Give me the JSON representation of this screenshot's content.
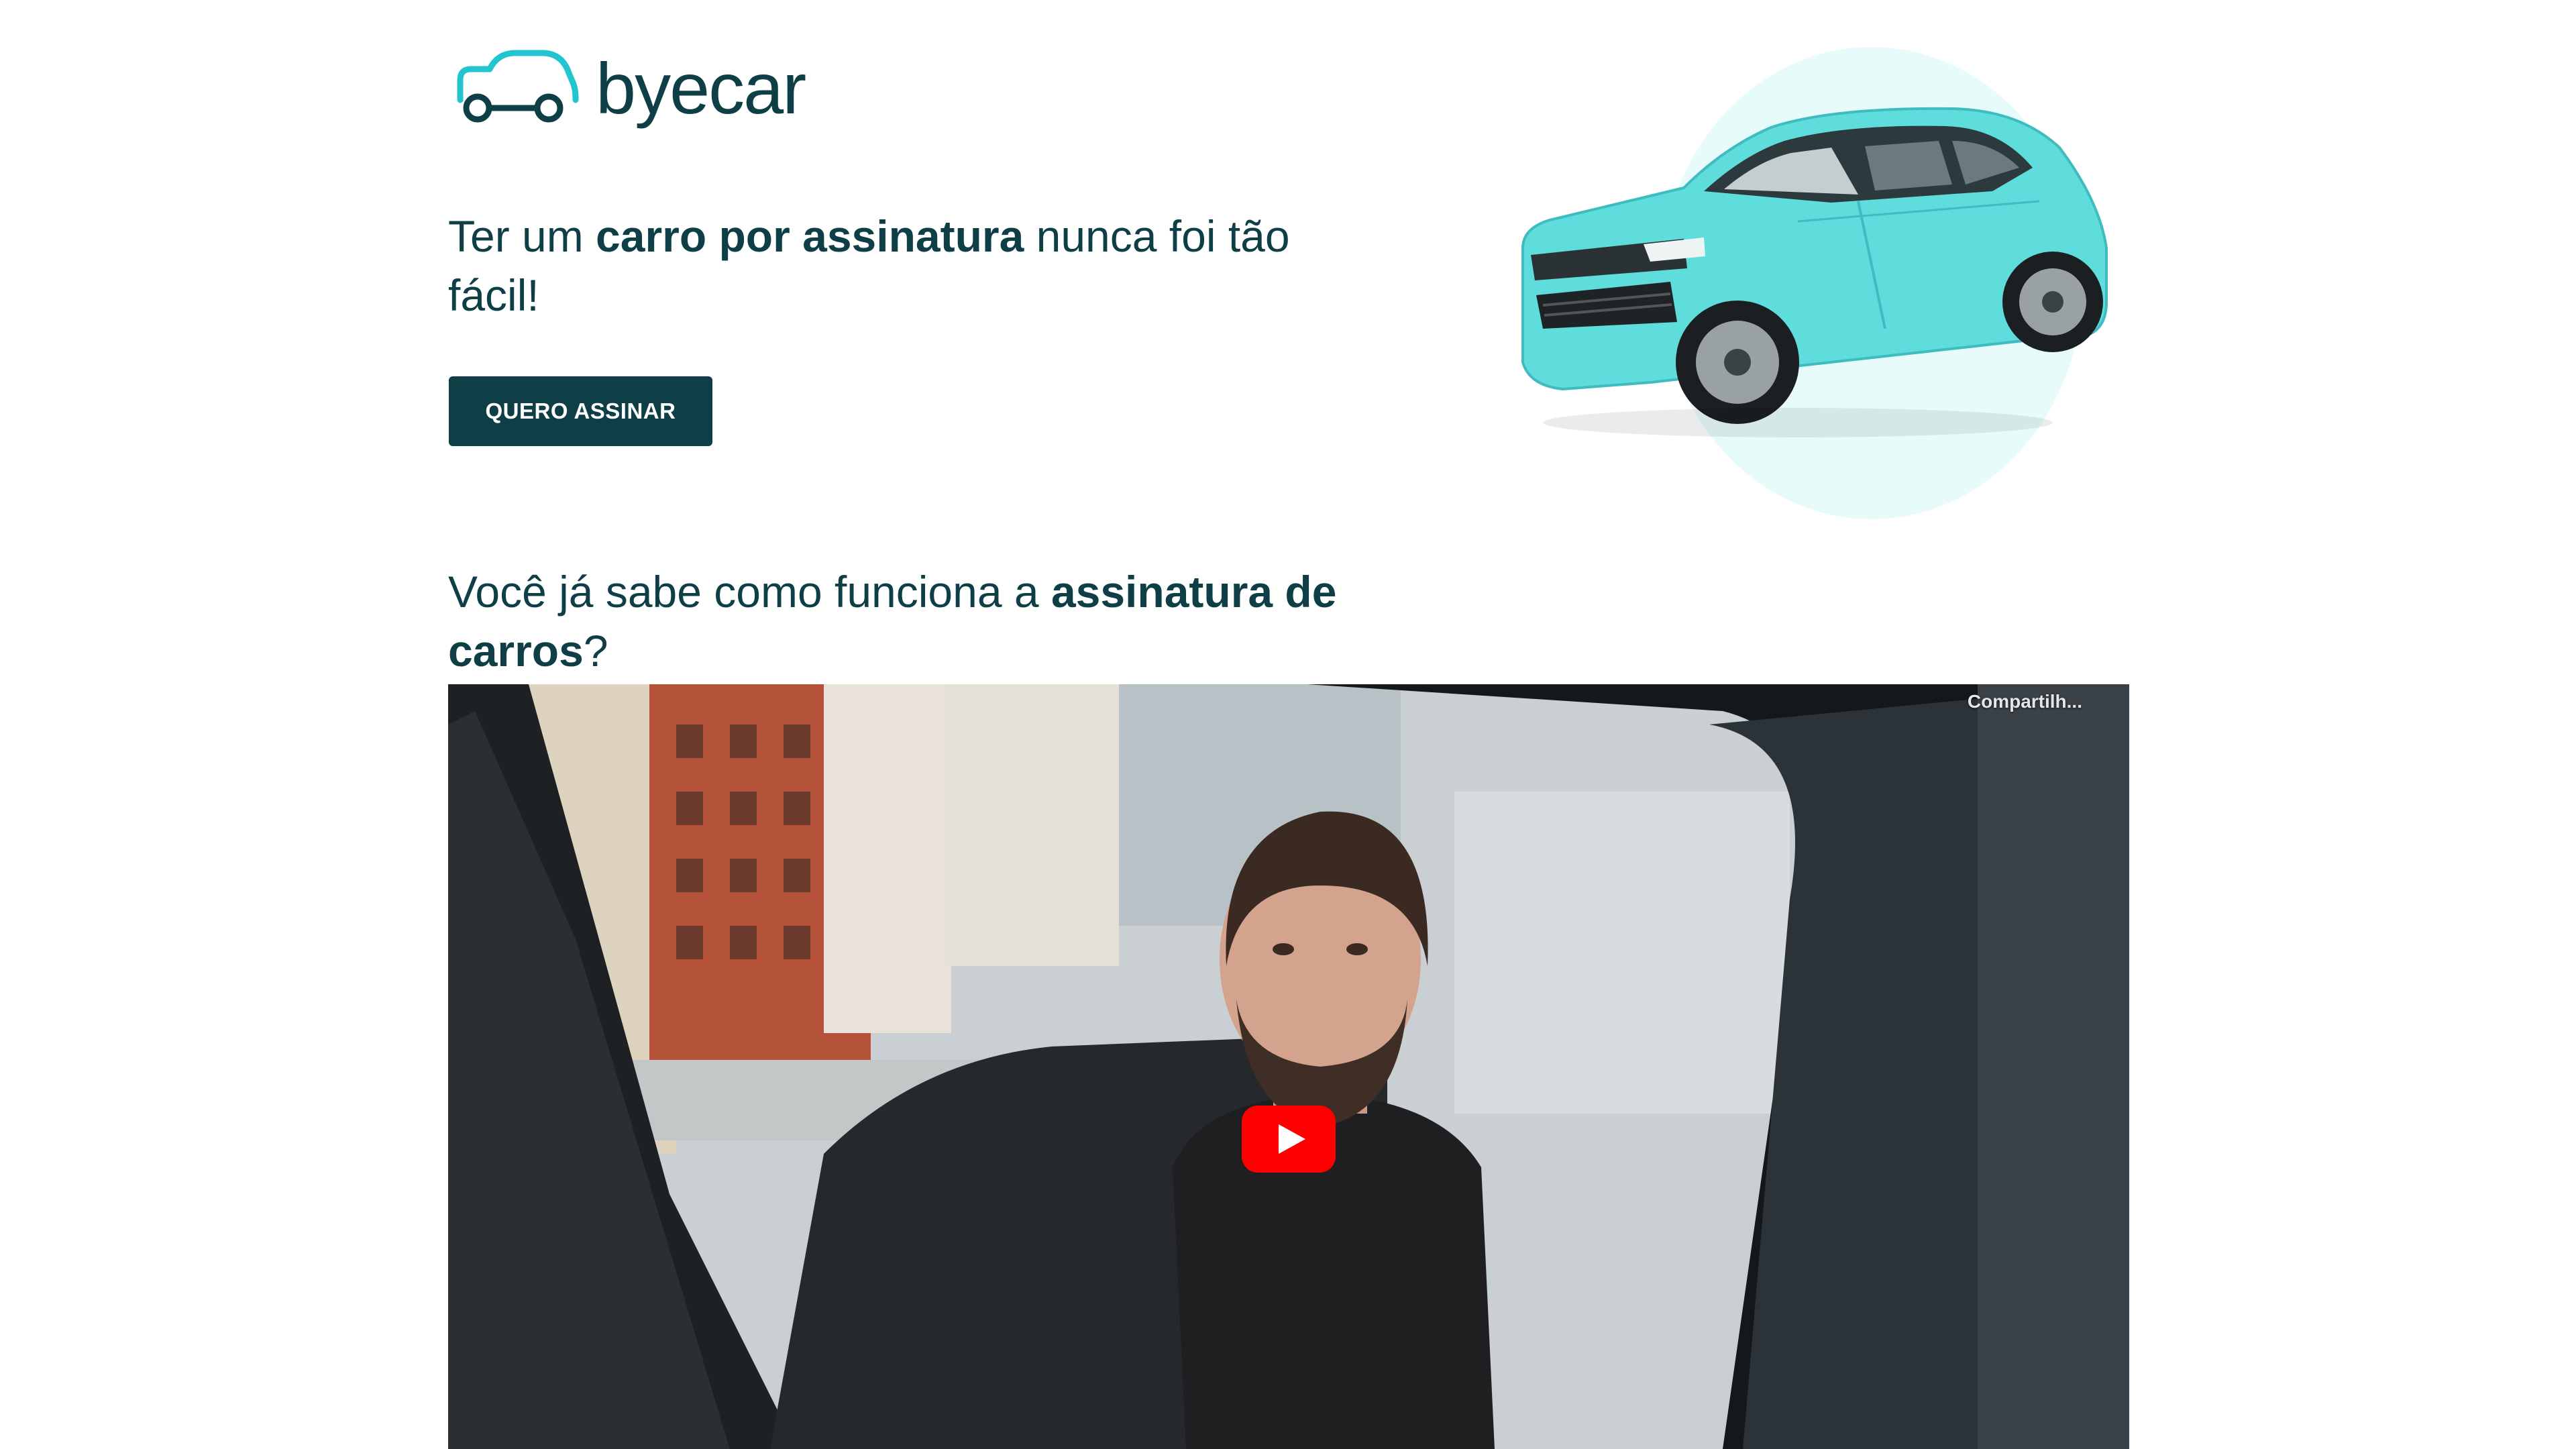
{
  "brand": {
    "name": "byecar",
    "logo_icon": "car-outline-icon",
    "primary_color": "#0f3f46",
    "accent_color": "#22c5cf"
  },
  "hero": {
    "headline_part1": "Ter um ",
    "headline_bold": "carro por assinatura",
    "headline_part2": " nunca foi tão fácil!",
    "cta_label": "QUERO ASSINAR",
    "image": "turquoise-hatchback-car-illustration"
  },
  "section": {
    "title_part1": "Você já sabe como funciona a ",
    "title_bold1": "assinatura de carros",
    "title_part2": "?"
  },
  "video": {
    "share_label": "Compartilh...",
    "play_icon": "youtube-play-icon",
    "play_color": "#ff0000",
    "thumbnail": "man-sitting-in-car-doorway"
  }
}
